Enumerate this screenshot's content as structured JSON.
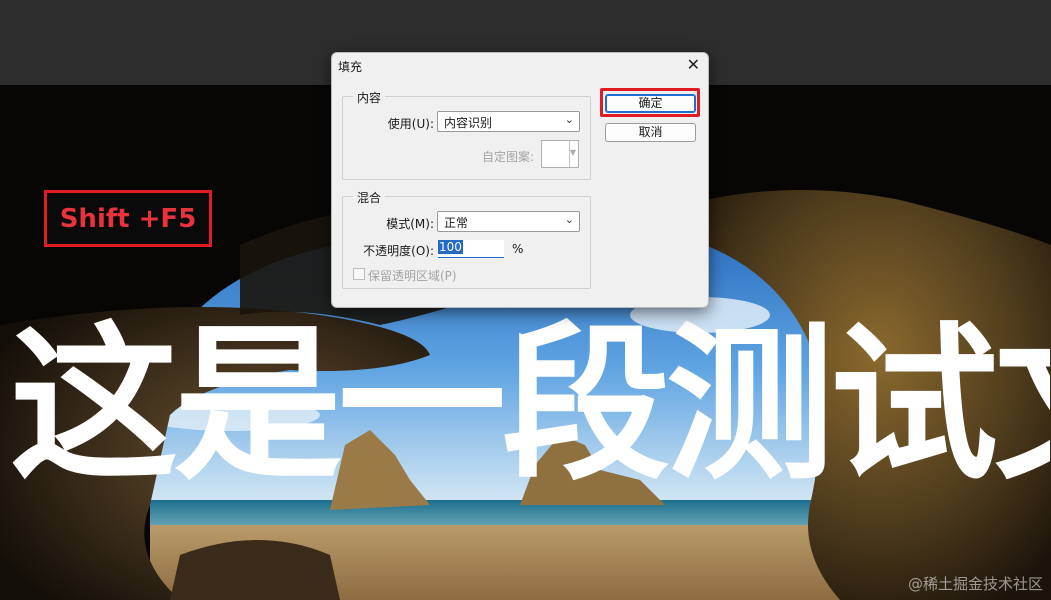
{
  "dialog": {
    "title": "填充",
    "close_glyph": "✕",
    "content_group": {
      "label": "内容",
      "use_label": "使用(U):",
      "use_value": "内容识别",
      "custom_pattern_label": "自定图案:"
    },
    "blend_group": {
      "label": "混合",
      "mode_label": "模式(M):",
      "mode_value": "正常",
      "opacity_label": "不透明度(O):",
      "opacity_value": "100",
      "opacity_unit": "%",
      "preserve_label": "保留透明区域(P)",
      "preserve_checked": false
    },
    "ok_label": "确定",
    "cancel_label": "取消"
  },
  "canvas": {
    "shortcut_hint": "Shift +F5",
    "big_text": "这是一段测试文字",
    "watermark": "@稀土掘金技术社区"
  },
  "colors": {
    "highlight_red": "#e01b24",
    "dialog_bg": "#f0f0f0",
    "accent_blue": "#1e6fd0"
  },
  "icons": {
    "close": "close-icon",
    "dropdown": "chevron-down-icon"
  }
}
